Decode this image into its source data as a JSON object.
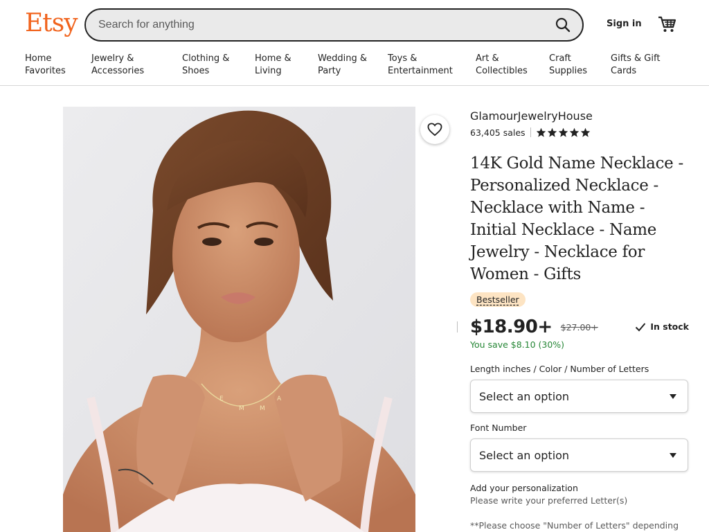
{
  "header": {
    "logo": "Etsy",
    "search_placeholder": "Search for anything",
    "sign_in": "Sign in"
  },
  "nav": {
    "items": [
      {
        "label": "Home\nFavorites"
      },
      {
        "label": "Jewelry &\nAccessories"
      },
      {
        "label": "Clothing &\nShoes"
      },
      {
        "label": "Home &\nLiving"
      },
      {
        "label": "Wedding &\nParty"
      },
      {
        "label": "Toys &\nEntertainment"
      },
      {
        "label": "Art &\nCollectibles"
      },
      {
        "label": "Craft\nSupplies"
      },
      {
        "label": "Gifts & Gift\nCards"
      }
    ]
  },
  "image": {
    "necklace_letters": [
      "E",
      "M",
      "M",
      "A"
    ]
  },
  "product": {
    "shop_name": "GlamourJewelryHouse",
    "sales": "63,405 sales",
    "rating_stars": 5,
    "title": "14K Gold Name Necklace - Personalized Necklace - Necklace with Name - Initial Necklace - Name Jewelry - Necklace for Women - Gifts",
    "badge": "Bestseller",
    "price": "$18.90+",
    "original_price": "$27.00+",
    "stock": "In stock",
    "savings": "You save $8.10 (30%)",
    "option1_label": "Length inches / Color / Number of Letters",
    "option1_value": "Select an option",
    "option2_label": "Font Number",
    "option2_value": "Select an option",
    "personalization_label": "Add your personalization",
    "personalization_hint": "Please write your preferred Letter(s)",
    "personalization_note": "**Please choose \"Number of Letters\" depending how many letters your name consists of. **"
  },
  "colors": {
    "brand": "#F1641E",
    "savings": "#258635",
    "badge_bg": "#FDE4C3"
  }
}
